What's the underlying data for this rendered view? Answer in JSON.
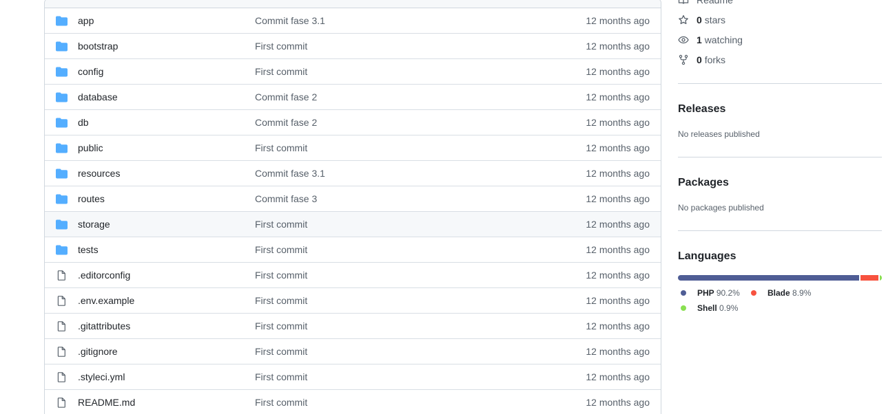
{
  "files": [
    {
      "name": "app",
      "type": "folder",
      "message": "Commit fase 3.1",
      "age": "12 months ago"
    },
    {
      "name": "bootstrap",
      "type": "folder",
      "message": "First commit",
      "age": "12 months ago"
    },
    {
      "name": "config",
      "type": "folder",
      "message": "First commit",
      "age": "12 months ago"
    },
    {
      "name": "database",
      "type": "folder",
      "message": "Commit fase 2",
      "age": "12 months ago"
    },
    {
      "name": "db",
      "type": "folder",
      "message": "Commit fase 2",
      "age": "12 months ago"
    },
    {
      "name": "public",
      "type": "folder",
      "message": "First commit",
      "age": "12 months ago"
    },
    {
      "name": "resources",
      "type": "folder",
      "message": "Commit fase 3.1",
      "age": "12 months ago"
    },
    {
      "name": "routes",
      "type": "folder",
      "message": "Commit fase 3",
      "age": "12 months ago"
    },
    {
      "name": "storage",
      "type": "folder",
      "message": "First commit",
      "age": "12 months ago"
    },
    {
      "name": "tests",
      "type": "folder",
      "message": "First commit",
      "age": "12 months ago"
    },
    {
      "name": ".editorconfig",
      "type": "file",
      "message": "First commit",
      "age": "12 months ago"
    },
    {
      "name": ".env.example",
      "type": "file",
      "message": "First commit",
      "age": "12 months ago"
    },
    {
      "name": ".gitattributes",
      "type": "file",
      "message": "First commit",
      "age": "12 months ago"
    },
    {
      "name": ".gitignore",
      "type": "file",
      "message": "First commit",
      "age": "12 months ago"
    },
    {
      "name": ".styleci.yml",
      "type": "file",
      "message": "First commit",
      "age": "12 months ago"
    },
    {
      "name": "README.md",
      "type": "file",
      "message": "First commit",
      "age": "12 months ago"
    }
  ],
  "sidebar": {
    "readme_label": "Readme",
    "stars": {
      "count": "0",
      "label": "stars"
    },
    "watching": {
      "count": "1",
      "label": "watching"
    },
    "forks": {
      "count": "0",
      "label": "forks"
    },
    "releases": {
      "title": "Releases",
      "note": "No releases published"
    },
    "packages": {
      "title": "Packages",
      "note": "No packages published"
    },
    "languages": {
      "title": "Languages",
      "items": [
        {
          "name": "PHP",
          "percent": "90.2%",
          "value": 90.2,
          "color": "#4F5D95"
        },
        {
          "name": "Blade",
          "percent": "8.9%",
          "value": 8.9,
          "color": "#f7523f"
        },
        {
          "name": "Shell",
          "percent": "0.9%",
          "value": 0.9,
          "color": "#89e051"
        }
      ]
    }
  },
  "colors": {
    "folder_icon": "#54aeff",
    "file_icon": "#57606a",
    "border": "#d0d7de"
  }
}
